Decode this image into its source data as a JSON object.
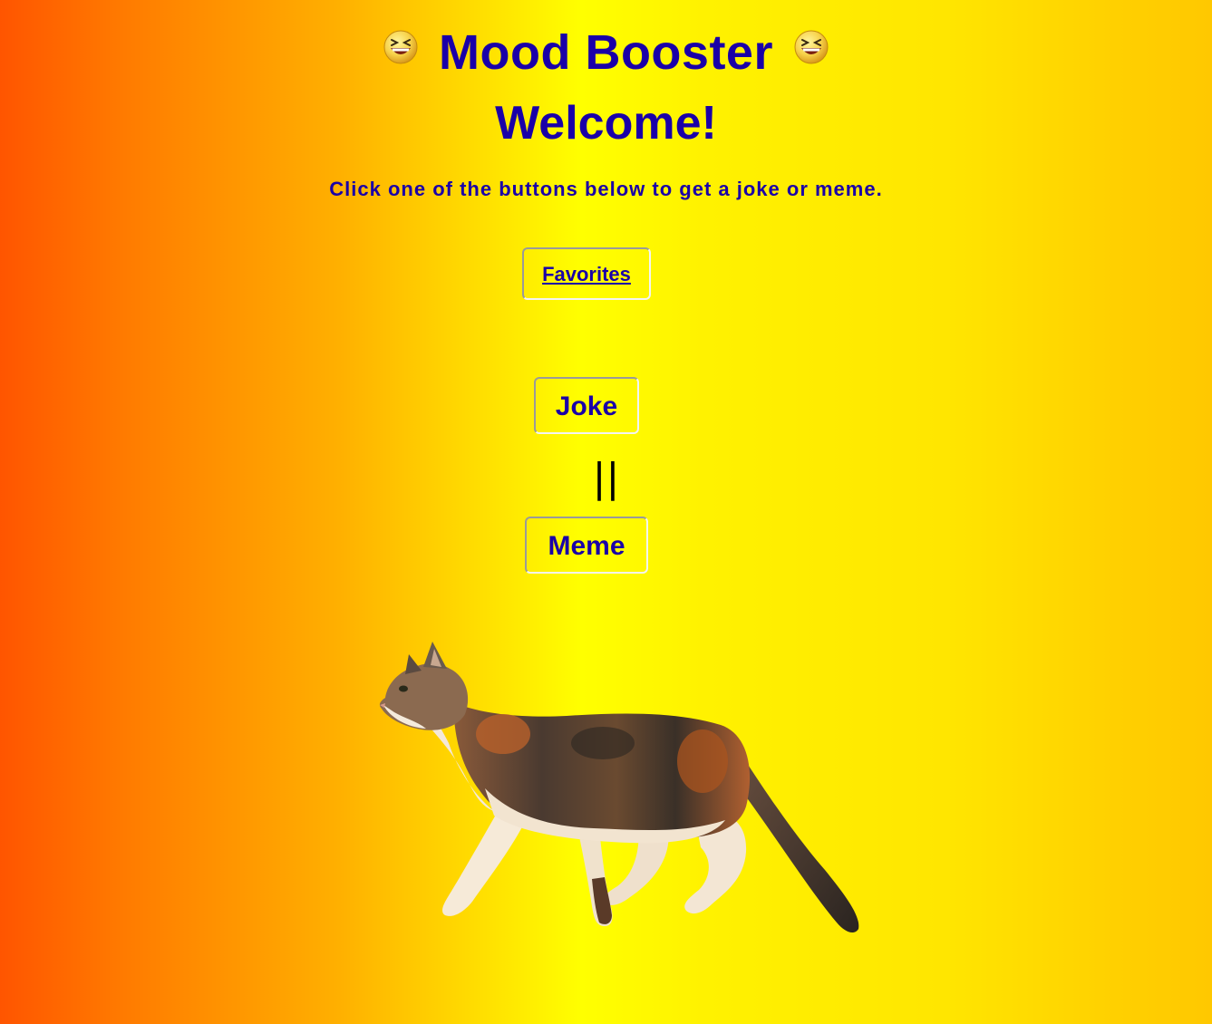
{
  "header": {
    "title": "Mood Booster",
    "left_icon": "grinning-squinting-face-icon",
    "right_icon": "grinning-squinting-face-icon"
  },
  "welcome": {
    "heading": "Welcome!",
    "instruction": "Click one of the buttons below to get a joke or meme."
  },
  "buttons": {
    "favorites_label": "Favorites",
    "joke_label": "Joke",
    "separator": "||",
    "meme_label": "Meme"
  },
  "image": {
    "subject": "calico-cat-illustration"
  },
  "colors": {
    "text": "#1a00a8",
    "gradient_left": "#ff5500",
    "gradient_center": "#ffff00",
    "gradient_right": "#ffc800"
  }
}
